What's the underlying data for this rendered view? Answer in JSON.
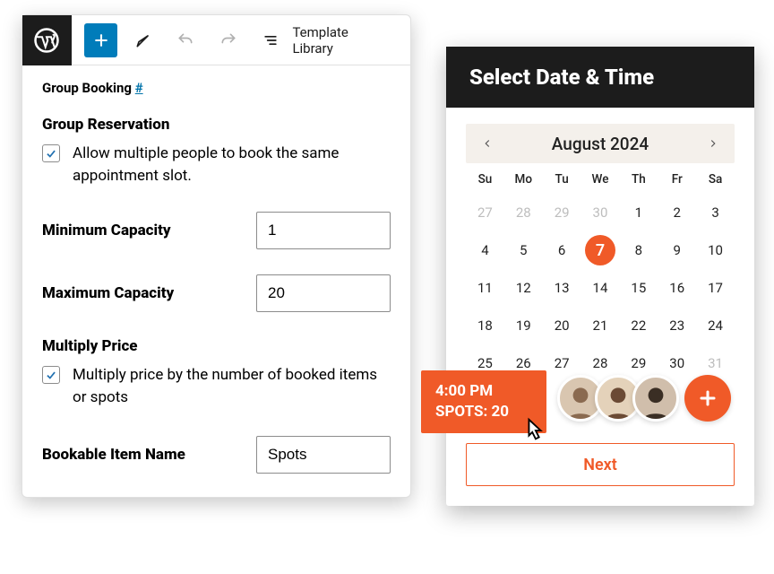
{
  "toolbar": {
    "template_library": "Template Library"
  },
  "editor": {
    "crumb_label": "Group Booking",
    "crumb_hash": "#",
    "group_reservation_heading": "Group Reservation",
    "group_reservation_checkbox": "Allow multiple people to book the same appointment slot.",
    "min_capacity_label": "Minimum Capacity",
    "min_capacity_value": "1",
    "max_capacity_label": "Maximum Capacity",
    "max_capacity_value": "20",
    "multiply_price_heading": "Multiply Price",
    "multiply_price_checkbox": "Multiply price by the number of booked items or spots",
    "bookable_item_label": "Bookable Item Name",
    "bookable_item_value": "Spots"
  },
  "datepicker": {
    "title": "Select Date & Time",
    "month": "August 2024",
    "dow": [
      "Su",
      "Mo",
      "Tu",
      "We",
      "Th",
      "Fr",
      "Sa"
    ],
    "weeks": [
      [
        {
          "n": "27",
          "dim": true
        },
        {
          "n": "28",
          "dim": true
        },
        {
          "n": "29",
          "dim": true
        },
        {
          "n": "30",
          "dim": true
        },
        {
          "n": "1"
        },
        {
          "n": "2"
        },
        {
          "n": "3"
        }
      ],
      [
        {
          "n": "4"
        },
        {
          "n": "5"
        },
        {
          "n": "6"
        },
        {
          "n": "7",
          "sel": true
        },
        {
          "n": "8"
        },
        {
          "n": "9"
        },
        {
          "n": "10"
        }
      ],
      [
        {
          "n": "11"
        },
        {
          "n": "12"
        },
        {
          "n": "13"
        },
        {
          "n": "14"
        },
        {
          "n": "15"
        },
        {
          "n": "16"
        },
        {
          "n": "17"
        }
      ],
      [
        {
          "n": "18"
        },
        {
          "n": "19"
        },
        {
          "n": "20"
        },
        {
          "n": "21"
        },
        {
          "n": "22"
        },
        {
          "n": "23"
        },
        {
          "n": "24"
        }
      ],
      [
        {
          "n": "25"
        },
        {
          "n": "26"
        },
        {
          "n": "27"
        },
        {
          "n": "28"
        },
        {
          "n": "29"
        },
        {
          "n": "30"
        },
        {
          "n": "31",
          "dim": true
        }
      ]
    ],
    "next_label": "Next"
  },
  "slot": {
    "time": "4:00 PM",
    "spots": "SPOTS: 20"
  }
}
